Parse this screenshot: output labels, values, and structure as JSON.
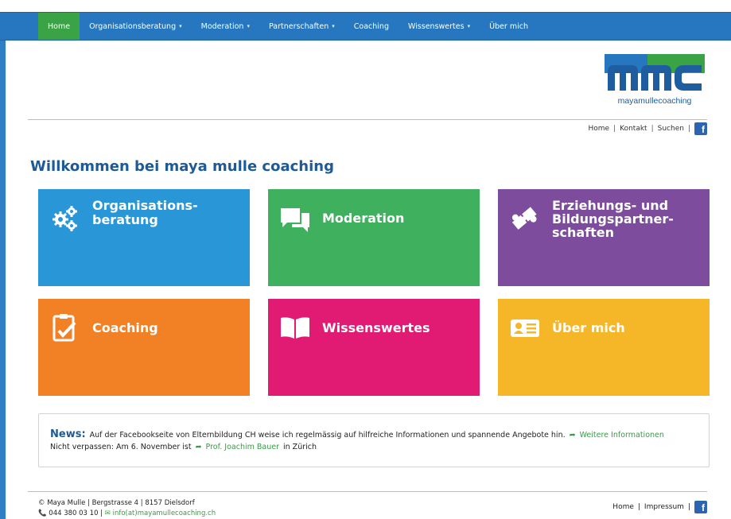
{
  "nav": {
    "items": [
      {
        "label": "Home",
        "active": true,
        "dropdown": false
      },
      {
        "label": "Organisationsberatung",
        "active": false,
        "dropdown": true
      },
      {
        "label": "Moderation",
        "active": false,
        "dropdown": true
      },
      {
        "label": "Partnerschaften",
        "active": false,
        "dropdown": true
      },
      {
        "label": "Coaching",
        "active": false,
        "dropdown": false
      },
      {
        "label": "Wissenswertes",
        "active": false,
        "dropdown": true
      },
      {
        "label": "Über mich",
        "active": false,
        "dropdown": false
      }
    ],
    "caret": "▾"
  },
  "logo": {
    "mark": "mmc",
    "text": "mayamullecoaching"
  },
  "utility": {
    "links": [
      "Home",
      "Kontakt",
      "Suchen"
    ],
    "separator": "|",
    "facebook": "f"
  },
  "title": "Willkommen bei maya mulle coaching",
  "tiles": [
    {
      "label": "Organisations-\nberatung",
      "icon": "gears-icon",
      "color": "#2996d7"
    },
    {
      "label": "Moderation",
      "icon": "chat-bubbles-icon",
      "color": "#3fb05d"
    },
    {
      "label": "Erziehungs- und\nBildungspartner-\nschaften",
      "icon": "puzzle-icon",
      "color": "#7d4c9d"
    },
    {
      "label": "Coaching",
      "icon": "clipboard-check-icon",
      "color": "#f28126"
    },
    {
      "label": "Wissenswertes",
      "icon": "open-book-icon",
      "color": "#e11b74"
    },
    {
      "label": "Über mich",
      "icon": "id-card-icon",
      "color": "#f5b727"
    }
  ],
  "news": {
    "label": "News:",
    "line1": "Auf der Facebookseite von Elternbildung CH weise ich regelmässig auf hilfreiche Informationen und spannende Angebote hin.",
    "link1": "Weitere Informationen",
    "line2_before": "Nicht verpassen: Am 6. November ist",
    "link2": "Prof. Joachim Bauer",
    "line2_after": "in Zürich"
  },
  "footer": {
    "address": "© Maya Mulle | Bergstrasse 4 | 8157 Dielsdorf",
    "phone": "044 380 03 10 |",
    "email": "info(at)mayamullecoaching.ch",
    "links": [
      "Home",
      "Impressum"
    ],
    "separator": "|",
    "facebook": "f"
  },
  "colors": {
    "nav": "#2677c0",
    "active": "#3aa346",
    "title": "#1e5a96",
    "link": "#3a9a45"
  }
}
